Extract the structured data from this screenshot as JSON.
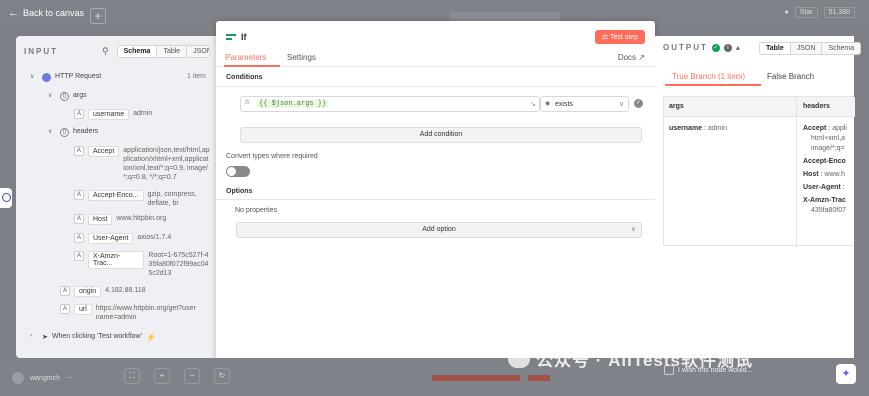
{
  "topbar": {
    "back_label": "Back to canvas",
    "github_star": "Star",
    "github_count": "51,380"
  },
  "input": {
    "title": "INPUT",
    "view_tabs": [
      "Schema",
      "Table",
      "JSON"
    ],
    "active_view": "Schema",
    "root_label": "HTTP Request",
    "root_count": "1 item",
    "args_label": "args",
    "args_items": [
      {
        "key": "username",
        "value": "admin"
      }
    ],
    "headers_label": "headers",
    "header_items": [
      {
        "key": "Accept",
        "value": "application/json,text/html,application/xhtml+xml,application/xml,text/*;q=0.9, image/*;q=0.8, */*;q=0.7"
      },
      {
        "key": "Accept-Enco...",
        "value": "gzip, compress, deflate, br"
      },
      {
        "key": "Host",
        "value": "www.httpbin.org"
      },
      {
        "key": "User-Agent",
        "value": "axios/1.7.4"
      },
      {
        "key": "X-Amzn-Trac...",
        "value": "Root=1-675c527f-435fa80f072f99ac045c2d13"
      }
    ],
    "origin": {
      "key": "origin",
      "value": "4.182.88.118"
    },
    "url": {
      "key": "url",
      "value": "https://www.httpbin.org/get?username=admin"
    },
    "trigger_label": "When clicking ‘Test workflow’"
  },
  "modal": {
    "node_title": "If",
    "test_step_label": "Test step",
    "tabs": [
      "Parameters",
      "Settings"
    ],
    "active_tab": "Parameters",
    "docs_label": "Docs",
    "conditions_label": "Conditions",
    "condition_expression": "{{ $json.args }}",
    "condition_operator": "exists",
    "add_condition_label": "Add condition",
    "convert_types_label": "Convert types where required",
    "options_label": "Options",
    "no_properties_label": "No properties",
    "add_option_label": "Add option"
  },
  "output": {
    "title": "OUTPUT",
    "view_tabs": [
      "Table",
      "JSON",
      "Schema"
    ],
    "active_view": "Table",
    "branch_tabs": [
      "True Branch (1 item)",
      "False Branch"
    ],
    "active_branch": "True Branch (1 item)",
    "columns": [
      "args",
      "headers"
    ],
    "args_cell": {
      "key": "username",
      "value": "admin"
    },
    "headers_cell": [
      {
        "key": "Accept",
        "value": "appli"
      },
      {
        "text": "html+xml,a"
      },
      {
        "text": "image/*;q="
      },
      {
        "key": "Accept-Enco",
        "value": ""
      },
      {
        "key": "Host",
        "value": "www.h"
      },
      {
        "key": "User-Agent",
        "value": ""
      },
      {
        "key": "X-Amzn-Trac",
        "value": ""
      },
      {
        "text": "435fa80f07"
      }
    ]
  },
  "bottombar": {
    "user_name": "wangmch",
    "wish_text": "I wish this node would..."
  },
  "watermark": "公众号 · AllTests软件测试"
}
